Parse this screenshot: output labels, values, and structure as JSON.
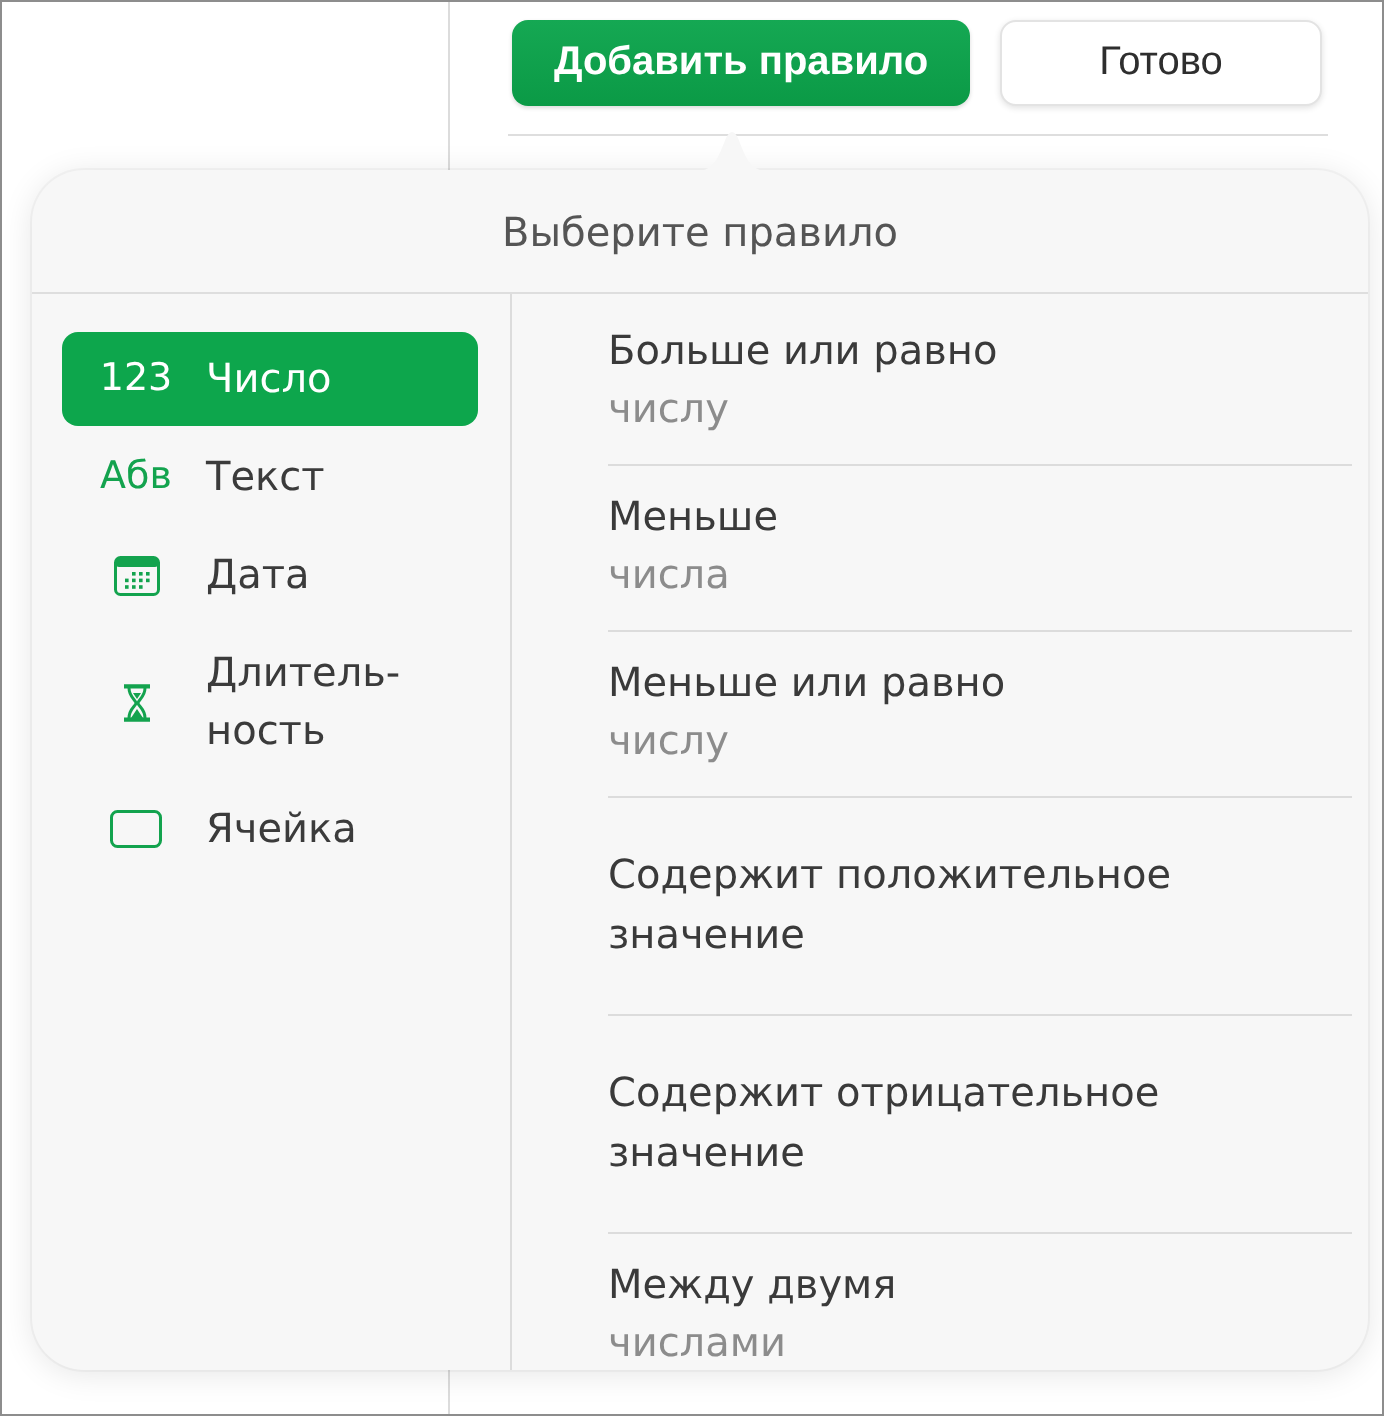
{
  "toolbar": {
    "buttons": [
      {
        "label": "Добавить правило",
        "kind": "primary"
      },
      {
        "label": "Готово",
        "kind": "secondary"
      }
    ]
  },
  "popover": {
    "title": "Выберите правило",
    "categories": [
      {
        "kind": "number",
        "glyph": "123",
        "label": "Число",
        "selected": true
      },
      {
        "kind": "text",
        "glyph": "Абв",
        "label": "Текст",
        "selected": false
      },
      {
        "kind": "date",
        "label": "Дата",
        "selected": false
      },
      {
        "kind": "duration",
        "label": "Длитель-ность",
        "selected": false
      },
      {
        "kind": "cell",
        "label": "Ячейка",
        "selected": false
      }
    ],
    "rules": [
      {
        "title": "Больше или равно",
        "subtitle": "числу"
      },
      {
        "title": "Меньше",
        "subtitle": "числа"
      },
      {
        "title": "Меньше или равно",
        "subtitle": "числу"
      },
      {
        "title": "Содержит положительное значение"
      },
      {
        "title": "Содержит отрицательное значение"
      },
      {
        "title": "Между двумя",
        "subtitle": "числами"
      }
    ]
  }
}
